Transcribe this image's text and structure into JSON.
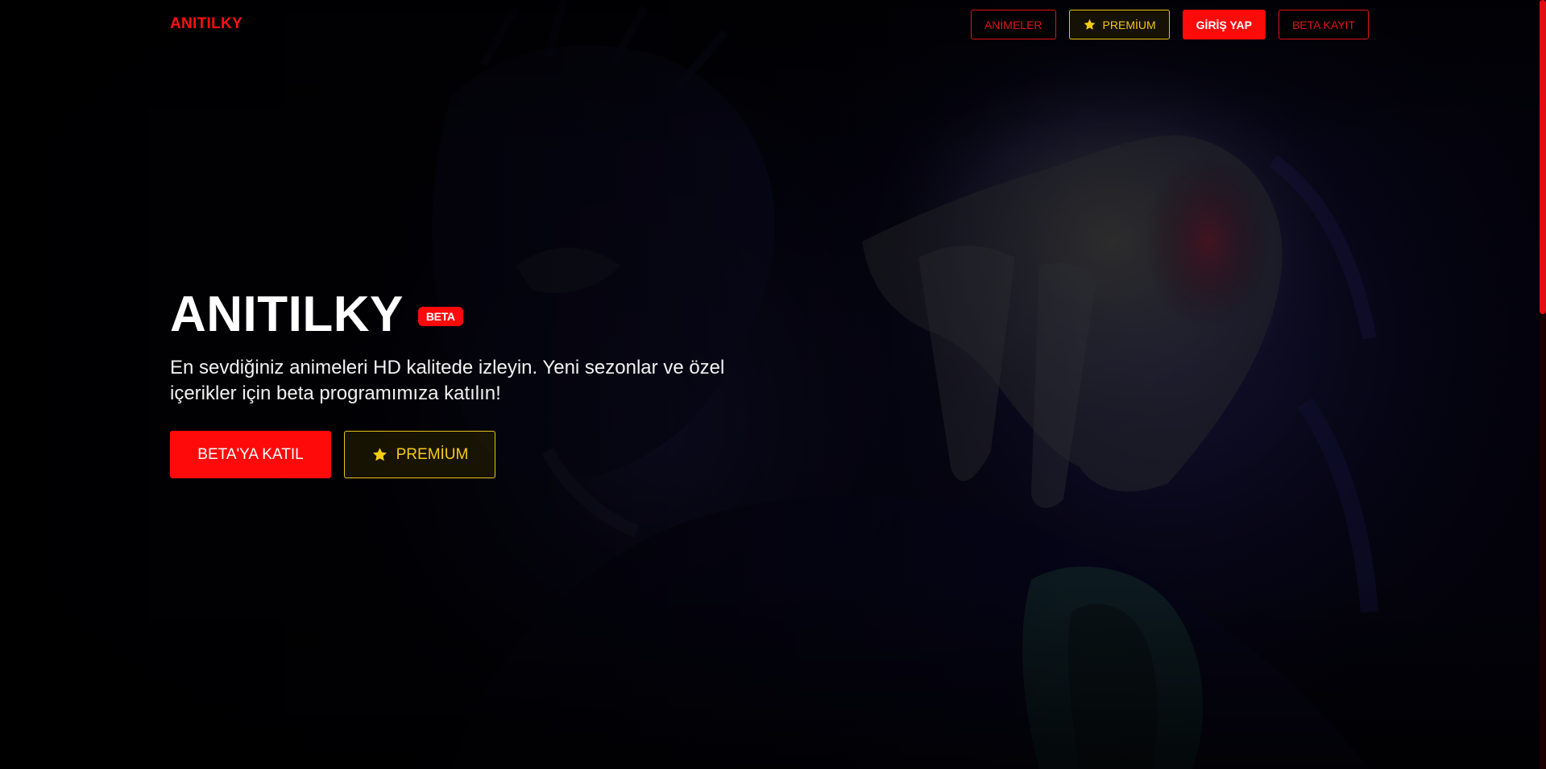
{
  "nav": {
    "brand": "ANITILKY",
    "animes_label": "ANİMELER",
    "premium_label": "PREMİUM",
    "login_label": "GİRİŞ YAP",
    "beta_signup_label": "BETA KAYIT"
  },
  "hero": {
    "title": "ANITILKY",
    "badge": "BETA",
    "description": "En sevdiğiniz animeleri HD kalitede izleyin. Yeni sezonlar ve özel içerikler için beta programımıza katılın!",
    "join_beta_label": "BETA'YA KATIL",
    "premium_label": "PREMİUM"
  },
  "icons": {
    "premium_nav": "star-icon",
    "premium_cta": "star-icon"
  },
  "colors": {
    "accent_red": "#ff0a0a",
    "premium_gold": "#f0c814",
    "background": "#020108"
  }
}
